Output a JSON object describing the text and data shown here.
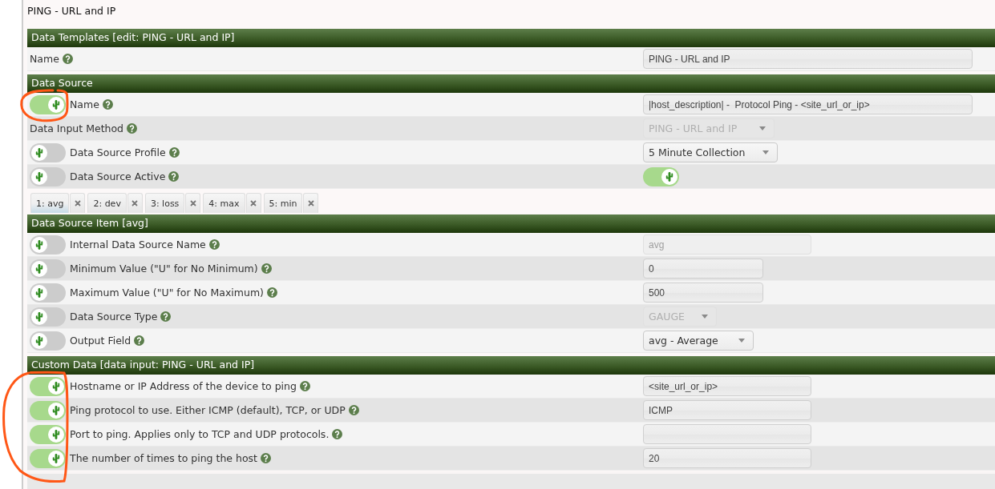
{
  "page_title": "PING - URL and IP",
  "sections": [
    {
      "title": "Data Templates [edit: PING - URL and IP]",
      "rows": [
        {
          "label": "Name",
          "field": {
            "kind": "input",
            "value": "PING - URL and IP",
            "disabled": false
          }
        }
      ]
    },
    {
      "title": "Data Source",
      "rows": [
        {
          "label": "Name",
          "toggle": {
            "on": true
          },
          "field": {
            "kind": "input",
            "value": "|host_description| -  Protocol Ping - <site_url_or_ip>",
            "disabled": false
          }
        },
        {
          "label": "Data Input Method",
          "field": {
            "kind": "select",
            "value": "PING - URL and IP",
            "disabled": true
          }
        },
        {
          "label": "Data Source Profile",
          "toggle": {
            "on": false
          },
          "field": {
            "kind": "select",
            "value": "5 Minute Collection",
            "disabled": false
          }
        },
        {
          "label": "Data Source Active",
          "toggle": {
            "on": false
          },
          "field": {
            "kind": "switch",
            "on": true
          }
        }
      ]
    },
    {
      "title": "Data Source Item [avg]",
      "tabs": [
        {
          "label": "1: avg",
          "selected": true
        },
        {
          "label": "2: dev",
          "selected": false
        },
        {
          "label": "3: loss",
          "selected": false
        },
        {
          "label": "4: max",
          "selected": false
        },
        {
          "label": "5: min",
          "selected": false
        }
      ],
      "rows": [
        {
          "label": "Internal Data Source Name",
          "toggle": {
            "on": false
          },
          "field": {
            "kind": "input",
            "value": "avg",
            "disabled": true
          }
        },
        {
          "label": "Minimum Value (\"U\" for No Minimum)",
          "toggle": {
            "on": false
          },
          "field": {
            "kind": "input",
            "value": "0",
            "disabled": false
          }
        },
        {
          "label": "Maximum Value (\"U\" for No Maximum)",
          "toggle": {
            "on": false
          },
          "field": {
            "kind": "input",
            "value": "500",
            "disabled": false
          }
        },
        {
          "label": "Data Source Type",
          "toggle": {
            "on": false
          },
          "field": {
            "kind": "select",
            "value": "GAUGE",
            "disabled": true
          }
        },
        {
          "label": "Output Field",
          "toggle": {
            "on": false
          },
          "field": {
            "kind": "select",
            "value": "avg - Average",
            "disabled": false
          }
        }
      ]
    },
    {
      "title": "Custom Data [data input: PING - URL and IP]",
      "rows": [
        {
          "label": "Hostname or IP Address of the device to ping",
          "toggle": {
            "on": true
          },
          "field": {
            "kind": "input",
            "value": "<site_url_or_ip>",
            "disabled": false
          }
        },
        {
          "label": "Ping protocol to use. Either ICMP (default), TCP, or UDP",
          "toggle": {
            "on": true
          },
          "field": {
            "kind": "input",
            "value": "ICMP",
            "disabled": false
          }
        },
        {
          "label": "Port to ping. Applies only to TCP and UDP protocols.",
          "toggle": {
            "on": true
          },
          "field": {
            "kind": "input",
            "disabled": false
          }
        },
        {
          "label": "The number of times to ping the host",
          "toggle": {
            "on": true
          },
          "field": {
            "kind": "input",
            "value": "20",
            "disabled": false
          }
        }
      ]
    }
  ]
}
